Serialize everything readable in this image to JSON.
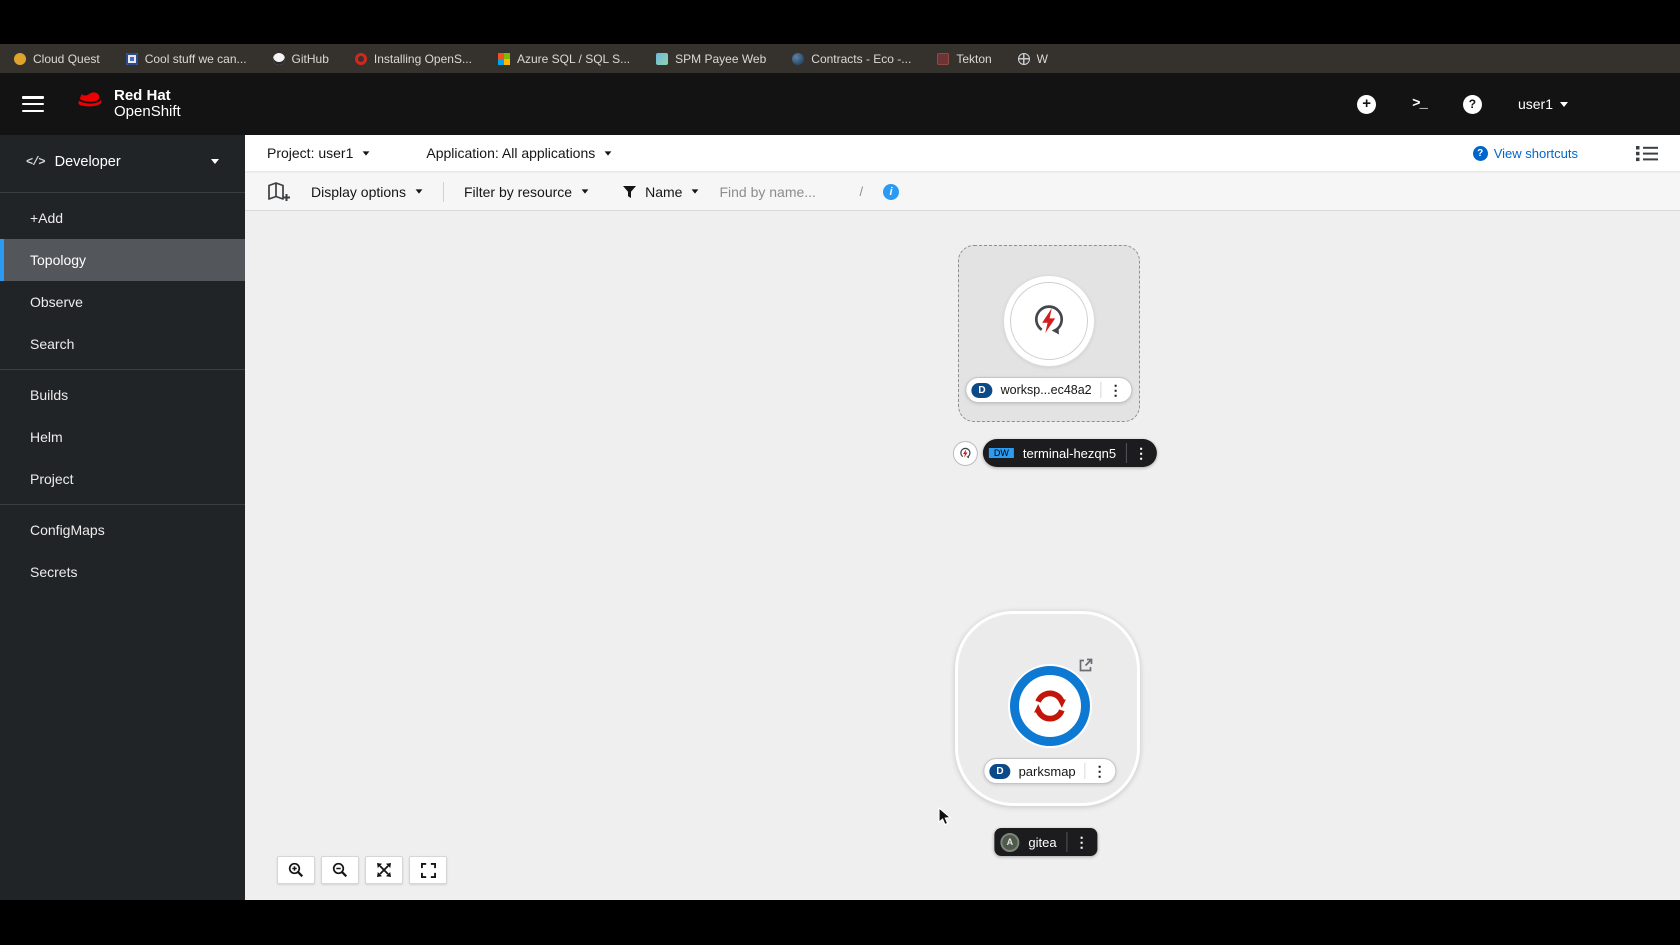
{
  "browser": {
    "bookmarks": [
      {
        "label": "Cloud Quest",
        "icon": "cloud-quest"
      },
      {
        "label": "Cool stuff we can...",
        "icon": "window"
      },
      {
        "label": "GitHub",
        "icon": "github"
      },
      {
        "label": "Installing OpenS...",
        "icon": "openshift-installer"
      },
      {
        "label": "Azure SQL / SQL S...",
        "icon": "azure"
      },
      {
        "label": "SPM Payee Web",
        "icon": "spm"
      },
      {
        "label": "Contracts - Eco -...",
        "icon": "contracts"
      },
      {
        "label": "Tekton",
        "icon": "tekton"
      },
      {
        "label": "W",
        "icon": "globe"
      }
    ]
  },
  "masthead": {
    "brand_line1": "Red Hat",
    "brand_line2": "OpenShift",
    "username": "user1"
  },
  "sidebar": {
    "perspective": "Developer",
    "items": [
      {
        "label": "+Add"
      },
      {
        "label": "Topology",
        "selected": true
      },
      {
        "label": "Observe"
      },
      {
        "label": "Search"
      },
      {
        "label": "Builds"
      },
      {
        "label": "Helm"
      },
      {
        "label": "Project"
      },
      {
        "label": "ConfigMaps"
      },
      {
        "label": "Secrets"
      }
    ]
  },
  "context_bar": {
    "project": "Project: user1",
    "application": "Application: All applications",
    "view_shortcuts": "View shortcuts"
  },
  "toolbar": {
    "display_options": "Display options",
    "filter_by_resource": "Filter by resource",
    "name_filter": "Name",
    "find_placeholder": "Find by name...",
    "shortcut_hint": "/"
  },
  "topology": {
    "workspace": {
      "badge": "D",
      "name": "worksp...ec48a2"
    },
    "terminal": {
      "badge": "DW",
      "name": "terminal-hezqn5"
    },
    "parksmap": {
      "badge": "D",
      "name": "parksmap"
    },
    "gitea": {
      "badge": "A",
      "name": "gitea"
    }
  },
  "colors": {
    "accent_blue": "#0066cc",
    "nav_selected_border": "#2b9af3",
    "badge_deployment": "#0c4a87",
    "badge_devworkspace": "#2d9bf0",
    "brand_red": "#ee0000",
    "workload_icon_red": "#c9190b",
    "parksmap_ring_blue": "#0d79d3"
  }
}
